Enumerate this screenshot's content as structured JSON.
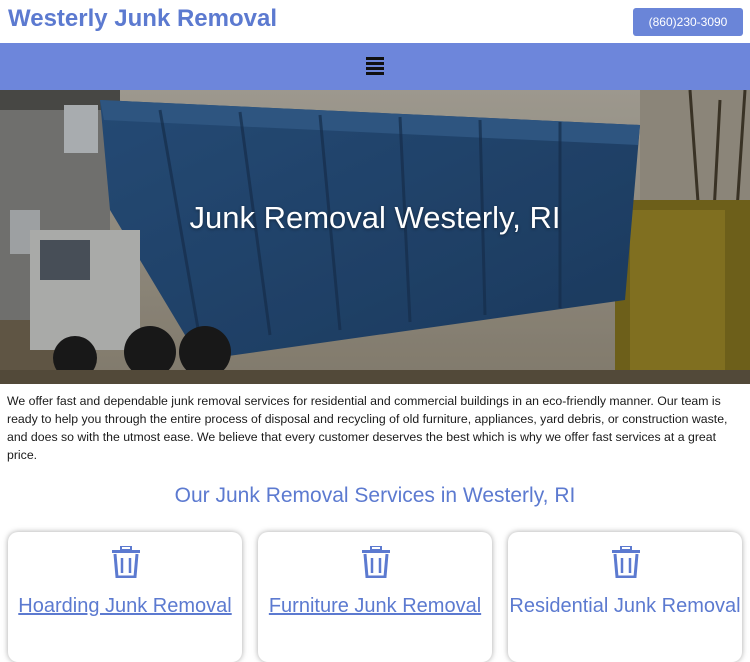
{
  "header": {
    "brand": "Westerly Junk Removal",
    "phone": "(860)230-3090"
  },
  "nav": {
    "menu_icon": "hamburger-menu-icon"
  },
  "hero": {
    "title": "Junk Removal Westerly, RI"
  },
  "intro": "We offer fast and dependable junk removal services for residential and commercial buildings in an eco-friendly manner. Our team is ready to help you through the entire process of disposal and recycling of old furniture, appliances, yard debris, or construction waste, and does so with the utmost ease. We believe that every customer deserves the best which is why we offer fast services at a great price.",
  "services": {
    "title": "Our Junk Removal Services in Westerly, RI",
    "cards": [
      {
        "title": "Hoarding Junk Removal",
        "icon": "trash-icon",
        "link": true
      },
      {
        "title": "Furniture Junk Removal",
        "icon": "trash-icon",
        "link": true
      },
      {
        "title": "Residential Junk Removal",
        "icon": "trash-icon",
        "link": false
      }
    ]
  },
  "colors": {
    "brand": "#5c7ad0",
    "nav": "#6d86db",
    "button": "#6a85d8"
  }
}
